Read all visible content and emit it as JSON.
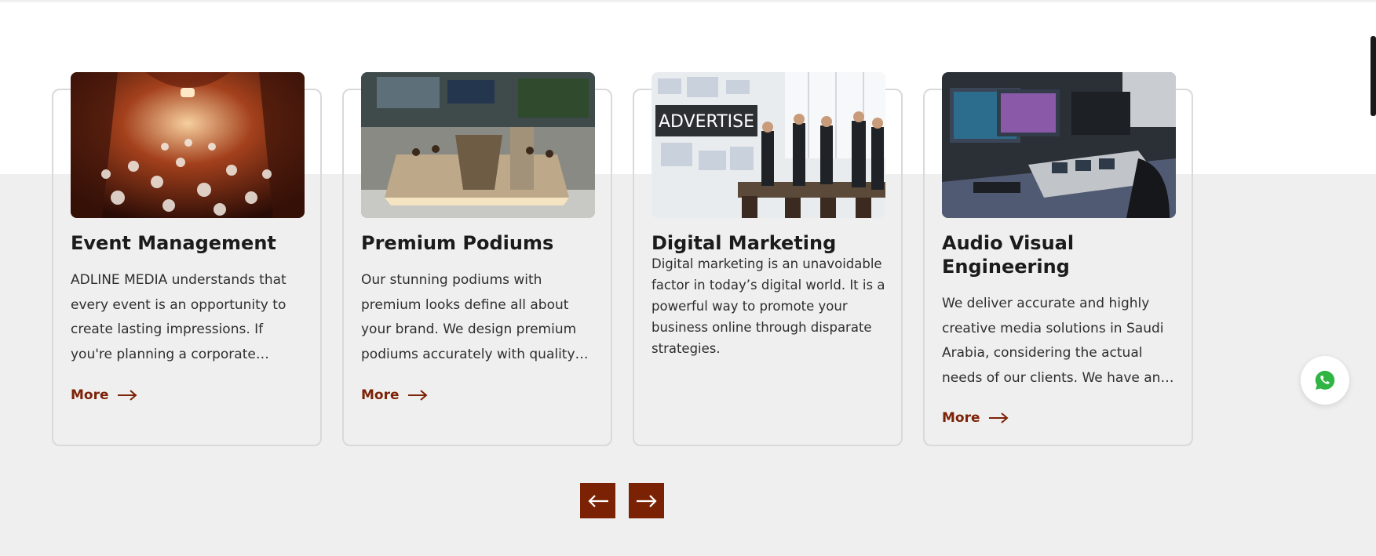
{
  "cards": [
    {
      "image": "event-hall-photo",
      "title": "Event Management",
      "text": "ADLINE MEDIA understands that every event is an opportunity to create lasting impressions. If you're planning a corporate conference, …",
      "more": "More"
    },
    {
      "image": "podium-booth-photo",
      "title": "Premium Podiums",
      "text": "Our stunning podiums with premium looks define all about your brand. We design premium podiums accurately with quality materials.…",
      "more": "More"
    },
    {
      "image": "advertise-office-photo",
      "image_text": "ADVERTISE",
      "title": "Digital Marketing",
      "text": "Digital marketing is an unavoidable factor in today’s digital world. It is a powerful way to promote your business online through disparate strategies."
    },
    {
      "image": "av-control-room-photo",
      "title": "Audio Visual Engineering",
      "text": "We deliver accurate and highly creative media solutions in Saudi Arabia, considering the actual needs of our clients. We have an…",
      "more": "More"
    }
  ],
  "carousel": {
    "prev_icon": "arrow-left-icon",
    "next_icon": "arrow-right-icon"
  },
  "floating": {
    "icon": "whatsapp-icon"
  },
  "colors": {
    "accent": "#7c2204",
    "link": "#7c2206",
    "background": "#efefef",
    "card_border": "#d9d9d9",
    "whatsapp_green": "#2fb543"
  }
}
